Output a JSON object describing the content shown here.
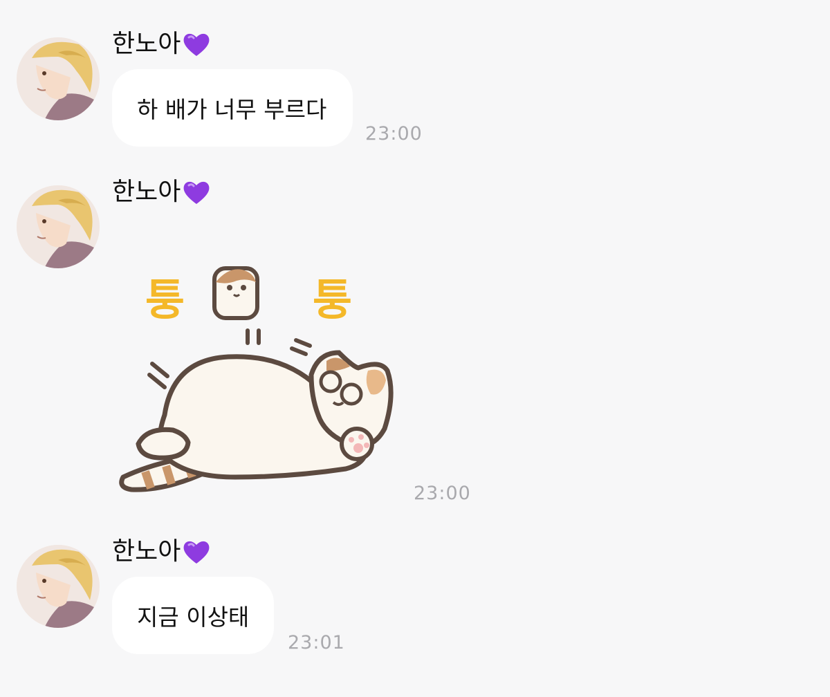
{
  "messages": [
    {
      "sender": "한노아",
      "text": "하 배가 너무 부르다",
      "time": "23:00"
    },
    {
      "sender": "한노아",
      "sticker": {
        "text_left": "퉁",
        "text_right": "퉁"
      },
      "time": "23:00"
    },
    {
      "sender": "한노아",
      "text": "지금 이상태",
      "time": "23:01"
    }
  ],
  "colors": {
    "background": "#f7f7f8",
    "bubble": "#ffffff",
    "timestamp": "#a9a9ad",
    "heart": "#8e3be0",
    "sticker_text": "#f4b829"
  }
}
